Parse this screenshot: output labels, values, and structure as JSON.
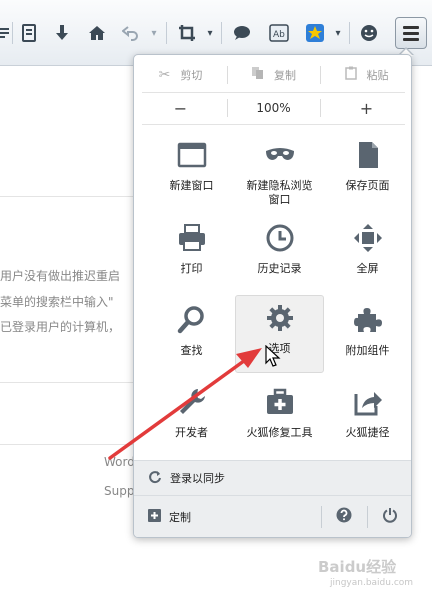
{
  "edit": {
    "cut": "剪切",
    "copy": "复制",
    "paste": "粘贴"
  },
  "zoom": {
    "minus": "−",
    "level": "100%",
    "plus": "+"
  },
  "items": {
    "new_window": "新建窗口",
    "private_line1": "新建隐私浏览",
    "private_line2": "窗口",
    "save_page": "保存页面",
    "print": "打印",
    "history": "历史记录",
    "fullscreen": "全屏",
    "find": "查找",
    "options": "选项",
    "addons": "附加组件",
    "developer": "开发者",
    "repair": "火狐修复工具",
    "shortcuts": "火狐捷径"
  },
  "sync_label": "登录以同步",
  "customize_label": "定制",
  "background_text": {
    "line1": "用户没有做出推迟重启",
    "line2": "菜单的搜索栏中输入\"",
    "line3": "已登录用户的计算机，",
    "line4": "Word",
    "line5": "Supp"
  },
  "watermark": {
    "brand": "Baidu经验",
    "url": "jingyan.baidu.com"
  },
  "colors": {
    "accent_arrow": "#e23b3b",
    "menu_bg": "#ffffff",
    "footer_bg": "#eceef0"
  }
}
